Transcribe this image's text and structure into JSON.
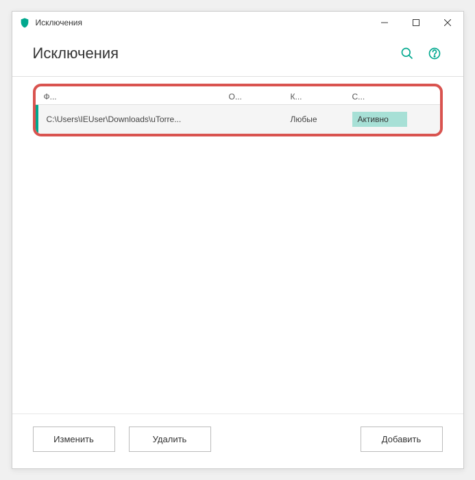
{
  "titlebar": {
    "title": "Исключения"
  },
  "header": {
    "title": "Исключения"
  },
  "table": {
    "columns": {
      "file": "Ф...",
      "object": "О...",
      "component": "К...",
      "status": "С..."
    },
    "rows": [
      {
        "file": "C:\\Users\\IEUser\\Downloads\\uTorre...",
        "object": "",
        "component": "Любые",
        "status": "Активно"
      }
    ]
  },
  "footer": {
    "edit": "Изменить",
    "delete": "Удалить",
    "add": "Добавить"
  }
}
